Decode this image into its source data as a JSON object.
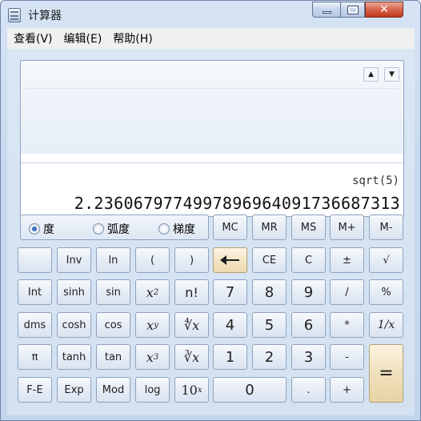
{
  "window": {
    "title": "计算器"
  },
  "menu": [
    "查看(V)",
    "编辑(E)",
    "帮助(H)"
  ],
  "display": {
    "expression": "sqrt(5)",
    "result": "2.2360679774997896964091736687313"
  },
  "angle_modes": [
    {
      "label": "度",
      "selected": true
    },
    {
      "label": "弧度",
      "selected": false
    },
    {
      "label": "梯度",
      "selected": false
    }
  ],
  "keys": {
    "mc": "MC",
    "mr": "MR",
    "ms": "MS",
    "mplus": "M+",
    "mminus": "M-",
    "inv": "Inv",
    "ln": "ln",
    "lparen": "(",
    "rparen": ")",
    "ce": "CE",
    "c": "C",
    "plusminus": "±",
    "sqrt": "√",
    "int": "Int",
    "sinh": "sinh",
    "sin": "sin",
    "x2_base": "x",
    "x2_exp": "2",
    "fact": "n!",
    "n7": "7",
    "n8": "8",
    "n9": "9",
    "div": "/",
    "pct": "%",
    "dms": "dms",
    "cosh": "cosh",
    "cos": "cos",
    "xy_base": "x",
    "xy_exp": "y",
    "yroot": "∜x",
    "n4": "4",
    "n5": "5",
    "n6": "6",
    "mul": "*",
    "recip": "1/x",
    "pi": "π",
    "tanh": "tanh",
    "tan": "tan",
    "x3_base": "x",
    "x3_exp": "3",
    "cbrt": "∛x",
    "n1": "1",
    "n2": "2",
    "n3": "3",
    "sub": "-",
    "eq": "=",
    "fe": "F-E",
    "exp": "Exp",
    "mod": "Mod",
    "log": "log",
    "tenx_base": "10",
    "tenx_exp": "x",
    "n0": "0",
    "dot": ".",
    "add": "+"
  }
}
